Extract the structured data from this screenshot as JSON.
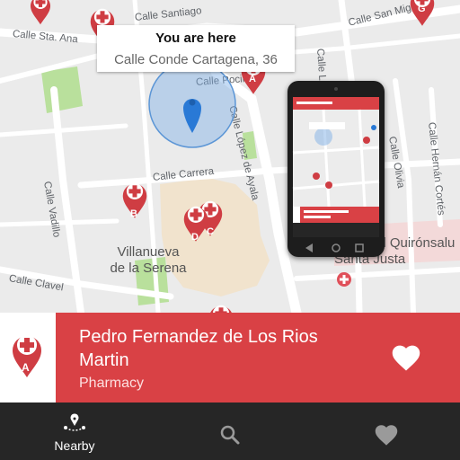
{
  "map": {
    "streets": [
      "Calle Sta. Ana",
      "Calle Santiago",
      "Calle San Miguel",
      "Calle Pocillo",
      "Calle Luis",
      "Calle López de Ayala",
      "Calle Carrera",
      "Calle Vadillo",
      "Calle Clavel",
      "Calle Hernán Cortés",
      "Calle Olivia"
    ],
    "places": [
      "Villanueva de la Serena",
      "Hospital Quirónsalud Santa Justa"
    ],
    "place_lines": [
      "Villanueva",
      "de la Serena",
      "al Quirónsalu",
      "Santa Justa"
    ],
    "markers": [
      "A",
      "B",
      "C",
      "D",
      "G"
    ]
  },
  "callout": {
    "title": "You are here",
    "address": "Calle Conde Cartagena, 36"
  },
  "selected": {
    "marker_letter": "A",
    "name": "Pedro Fernandez de Los Rios Martin",
    "type": "Pharmacy"
  },
  "nav": {
    "tabs": [
      {
        "label": "Nearby",
        "icon": "nearby-icon",
        "active": true
      },
      {
        "label": "",
        "icon": "search-icon",
        "active": false
      },
      {
        "label": "",
        "icon": "heart-icon",
        "active": false
      }
    ]
  },
  "colors": {
    "accent": "#d94145",
    "nav_bg": "#262626",
    "location": "#2979d6"
  }
}
